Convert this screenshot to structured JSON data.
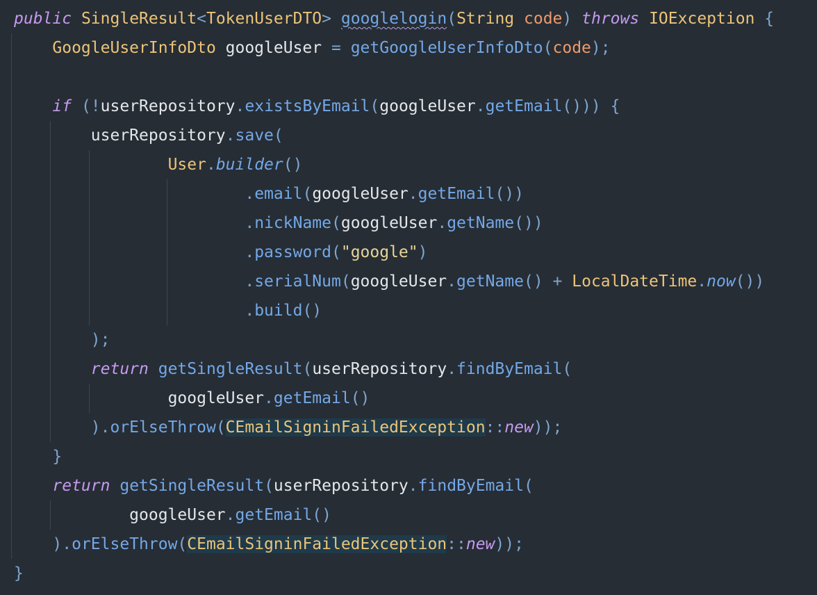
{
  "editor": {
    "lines": [
      {
        "tokens": [
          {
            "t": "public",
            "c": "kw"
          },
          {
            "t": " ",
            "c": "pl"
          },
          {
            "t": "SingleResult",
            "c": "ty"
          },
          {
            "t": "<",
            "c": "pu"
          },
          {
            "t": "TokenUserDTO",
            "c": "ty"
          },
          {
            "t": ">",
            "c": "pu"
          },
          {
            "t": " ",
            "c": "pl"
          },
          {
            "t": "googlelogin",
            "c": "fn err"
          },
          {
            "t": "(",
            "c": "pu"
          },
          {
            "t": "String",
            "c": "ty"
          },
          {
            "t": " ",
            "c": "pl"
          },
          {
            "t": "code",
            "c": "pa"
          },
          {
            "t": ")",
            "c": "pu"
          },
          {
            "t": " ",
            "c": "pl"
          },
          {
            "t": "throws",
            "c": "kw"
          },
          {
            "t": " ",
            "c": "pl"
          },
          {
            "t": "IOException",
            "c": "ty"
          },
          {
            "t": " ",
            "c": "pl"
          },
          {
            "t": "{",
            "c": "pu"
          }
        ]
      },
      {
        "tokens": [
          {
            "t": "    ",
            "c": "pl"
          },
          {
            "t": "GoogleUserInfoDto",
            "c": "ty"
          },
          {
            "t": " googleUser ",
            "c": "pl"
          },
          {
            "t": "=",
            "c": "pu"
          },
          {
            "t": " ",
            "c": "pl"
          },
          {
            "t": "getGoogleUserInfoDto",
            "c": "fn"
          },
          {
            "t": "(",
            "c": "pu"
          },
          {
            "t": "code",
            "c": "pa"
          },
          {
            "t": ");",
            "c": "pu"
          }
        ]
      },
      {
        "tokens": []
      },
      {
        "tokens": [
          {
            "t": "    ",
            "c": "pl"
          },
          {
            "t": "if",
            "c": "kw"
          },
          {
            "t": " ",
            "c": "pl"
          },
          {
            "t": "(!",
            "c": "pu"
          },
          {
            "t": "userRepository",
            "c": "pl"
          },
          {
            "t": ".",
            "c": "pu"
          },
          {
            "t": "existsByEmail",
            "c": "fn"
          },
          {
            "t": "(",
            "c": "pu"
          },
          {
            "t": "googleUser",
            "c": "pl"
          },
          {
            "t": ".",
            "c": "pu"
          },
          {
            "t": "getEmail",
            "c": "fn"
          },
          {
            "t": "())) {",
            "c": "pu"
          }
        ]
      },
      {
        "tokens": [
          {
            "t": "        ",
            "c": "pl"
          },
          {
            "t": "userRepository",
            "c": "pl"
          },
          {
            "t": ".",
            "c": "pu"
          },
          {
            "t": "save",
            "c": "fn"
          },
          {
            "t": "(",
            "c": "pu"
          }
        ]
      },
      {
        "tokens": [
          {
            "t": "                ",
            "c": "pl"
          },
          {
            "t": "User",
            "c": "ty"
          },
          {
            "t": ".",
            "c": "pu"
          },
          {
            "t": "builder",
            "c": "fn it"
          },
          {
            "t": "()",
            "c": "pu"
          }
        ]
      },
      {
        "tokens": [
          {
            "t": "                        ",
            "c": "pl"
          },
          {
            "t": ".",
            "c": "pu"
          },
          {
            "t": "email",
            "c": "fn"
          },
          {
            "t": "(",
            "c": "pu"
          },
          {
            "t": "googleUser",
            "c": "pl"
          },
          {
            "t": ".",
            "c": "pu"
          },
          {
            "t": "getEmail",
            "c": "fn"
          },
          {
            "t": "())",
            "c": "pu"
          }
        ]
      },
      {
        "tokens": [
          {
            "t": "                        ",
            "c": "pl"
          },
          {
            "t": ".",
            "c": "pu"
          },
          {
            "t": "nickName",
            "c": "fn"
          },
          {
            "t": "(",
            "c": "pu"
          },
          {
            "t": "googleUser",
            "c": "pl"
          },
          {
            "t": ".",
            "c": "pu"
          },
          {
            "t": "getName",
            "c": "fn"
          },
          {
            "t": "())",
            "c": "pu"
          }
        ]
      },
      {
        "tokens": [
          {
            "t": "                        ",
            "c": "pl"
          },
          {
            "t": ".",
            "c": "pu"
          },
          {
            "t": "password",
            "c": "fn"
          },
          {
            "t": "(",
            "c": "pu"
          },
          {
            "t": "\"google\"",
            "c": "st"
          },
          {
            "t": ")",
            "c": "pu"
          }
        ]
      },
      {
        "tokens": [
          {
            "t": "                        ",
            "c": "pl"
          },
          {
            "t": ".",
            "c": "pu"
          },
          {
            "t": "serialNum",
            "c": "fn"
          },
          {
            "t": "(",
            "c": "pu"
          },
          {
            "t": "googleUser",
            "c": "pl"
          },
          {
            "t": ".",
            "c": "pu"
          },
          {
            "t": "getName",
            "c": "fn"
          },
          {
            "t": "()",
            "c": "pu"
          },
          {
            "t": " ",
            "c": "pl"
          },
          {
            "t": "+",
            "c": "pu"
          },
          {
            "t": " ",
            "c": "pl"
          },
          {
            "t": "LocalDateTime",
            "c": "ty"
          },
          {
            "t": ".",
            "c": "pu"
          },
          {
            "t": "now",
            "c": "fn it"
          },
          {
            "t": "())",
            "c": "pu"
          }
        ]
      },
      {
        "tokens": [
          {
            "t": "                        ",
            "c": "pl"
          },
          {
            "t": ".",
            "c": "pu"
          },
          {
            "t": "build",
            "c": "fn"
          },
          {
            "t": "()",
            "c": "pu"
          }
        ]
      },
      {
        "tokens": [
          {
            "t": "        ",
            "c": "pl"
          },
          {
            "t": ");",
            "c": "pu"
          }
        ]
      },
      {
        "tokens": [
          {
            "t": "        ",
            "c": "pl"
          },
          {
            "t": "return",
            "c": "kw"
          },
          {
            "t": " ",
            "c": "pl"
          },
          {
            "t": "getSingleResult",
            "c": "fn"
          },
          {
            "t": "(",
            "c": "pu"
          },
          {
            "t": "userRepository",
            "c": "pl"
          },
          {
            "t": ".",
            "c": "pu"
          },
          {
            "t": "findByEmail",
            "c": "fn"
          },
          {
            "t": "(",
            "c": "pu"
          }
        ]
      },
      {
        "tokens": [
          {
            "t": "                ",
            "c": "pl"
          },
          {
            "t": "googleUser",
            "c": "pl"
          },
          {
            "t": ".",
            "c": "pu"
          },
          {
            "t": "getEmail",
            "c": "fn"
          },
          {
            "t": "()",
            "c": "pu"
          }
        ]
      },
      {
        "tokens": [
          {
            "t": "        ",
            "c": "pl"
          },
          {
            "t": ").",
            "c": "pu"
          },
          {
            "t": "orElseThrow",
            "c": "fn"
          },
          {
            "t": "(",
            "c": "pu"
          },
          {
            "t": "CEmailSigninFailedException",
            "c": "ty hl"
          },
          {
            "t": "::",
            "c": "pu"
          },
          {
            "t": "new",
            "c": "kw"
          },
          {
            "t": "));",
            "c": "pu"
          }
        ]
      },
      {
        "tokens": [
          {
            "t": "    ",
            "c": "pl"
          },
          {
            "t": "}",
            "c": "pu"
          }
        ]
      },
      {
        "tokens": [
          {
            "t": "    ",
            "c": "pl"
          },
          {
            "t": "return",
            "c": "kw"
          },
          {
            "t": " ",
            "c": "pl"
          },
          {
            "t": "getSingleResult",
            "c": "fn"
          },
          {
            "t": "(",
            "c": "pu"
          },
          {
            "t": "userRepository",
            "c": "pl"
          },
          {
            "t": ".",
            "c": "pu"
          },
          {
            "t": "findByEmail",
            "c": "fn"
          },
          {
            "t": "(",
            "c": "pu"
          }
        ]
      },
      {
        "tokens": [
          {
            "t": "            ",
            "c": "pl"
          },
          {
            "t": "googleUser",
            "c": "pl"
          },
          {
            "t": ".",
            "c": "pu"
          },
          {
            "t": "getEmail",
            "c": "fn"
          },
          {
            "t": "()",
            "c": "pu"
          }
        ]
      },
      {
        "tokens": [
          {
            "t": "    ",
            "c": "pl"
          },
          {
            "t": ").",
            "c": "pu"
          },
          {
            "t": "orElseThrow",
            "c": "fn"
          },
          {
            "t": "(",
            "c": "pu"
          },
          {
            "t": "CEmailSigninFailedException",
            "c": "ty hl"
          },
          {
            "t": "::",
            "c": "pu"
          },
          {
            "t": "new",
            "c": "kw"
          },
          {
            "t": "));",
            "c": "pu"
          }
        ]
      },
      {
        "tokens": [
          {
            "t": "}",
            "c": "pu"
          }
        ]
      }
    ]
  }
}
